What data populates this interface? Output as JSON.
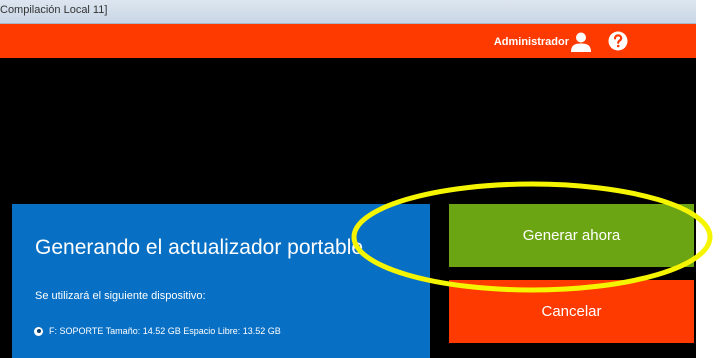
{
  "window": {
    "title": "Compilación Local 11]"
  },
  "header": {
    "user_name": "Administrador",
    "user_icon": "user-icon",
    "help_icon": "help-icon",
    "accent_color": "#fe3a00"
  },
  "panel": {
    "heading": "Generando el actualizador portable",
    "subtext": "Se utilizará el siguiente dispositivo:",
    "device_label": "F: SOPORTE Tamaño: 14.52 GB Espacio Libre: 13.52 GB",
    "background_color": "#0870c4"
  },
  "actions": {
    "generate_label": "Generar ahora",
    "generate_color": "#6ca514",
    "cancel_label": "Cancelar",
    "cancel_color": "#fe3a00"
  },
  "annotation": {
    "highlight_color": "#f5f500"
  }
}
